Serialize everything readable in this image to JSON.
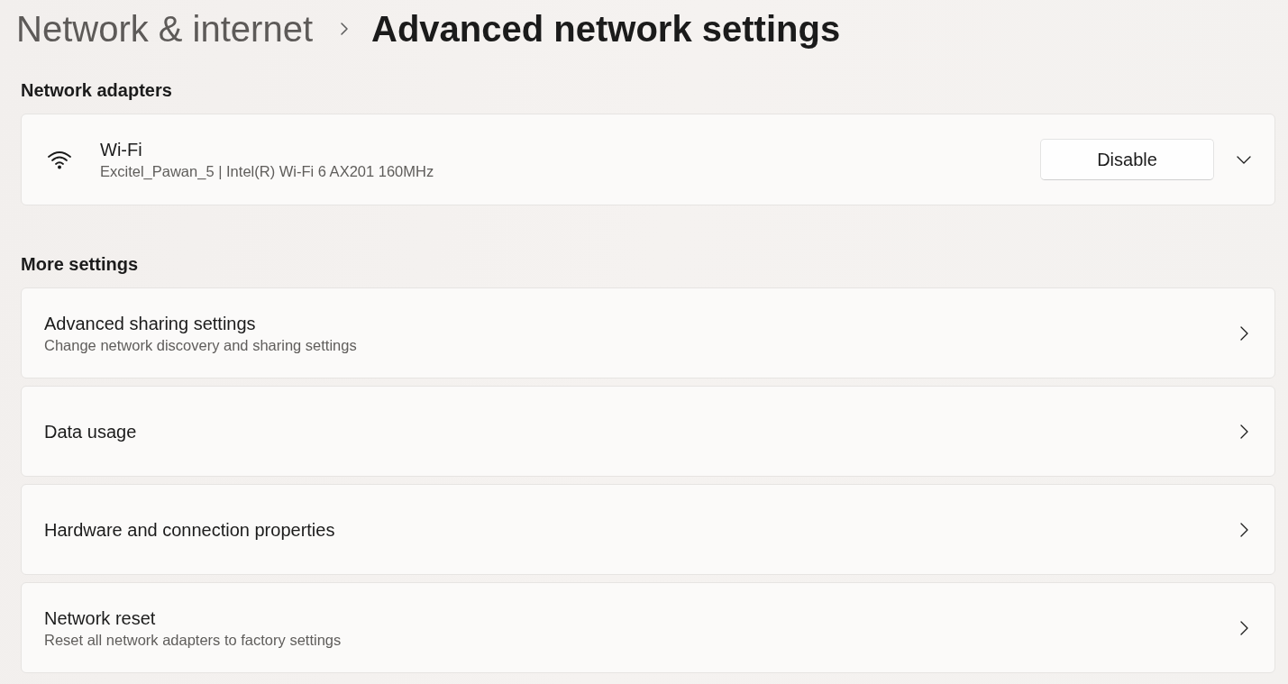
{
  "breadcrumb": [
    {
      "label": "Network & internet",
      "current": false
    },
    {
      "label": "Advanced network settings",
      "current": true
    }
  ],
  "sections": [
    {
      "heading": "Network adapters",
      "items": [
        {
          "kind": "adapter",
          "title": "Wi-Fi",
          "subtitle": "Excitel_Pawan_5 | Intel(R) Wi-Fi 6 AX201 160MHz",
          "button": "Disable",
          "expanded": false
        }
      ]
    },
    {
      "heading": "More settings",
      "items": [
        {
          "kind": "link",
          "title": "Advanced sharing settings",
          "subtitle": "Change network discovery and sharing settings"
        },
        {
          "kind": "link",
          "title": "Data usage"
        },
        {
          "kind": "link",
          "title": "Hardware and connection properties"
        },
        {
          "kind": "link",
          "title": "Network reset",
          "subtitle": "Reset all network adapters to factory settings"
        }
      ]
    }
  ]
}
